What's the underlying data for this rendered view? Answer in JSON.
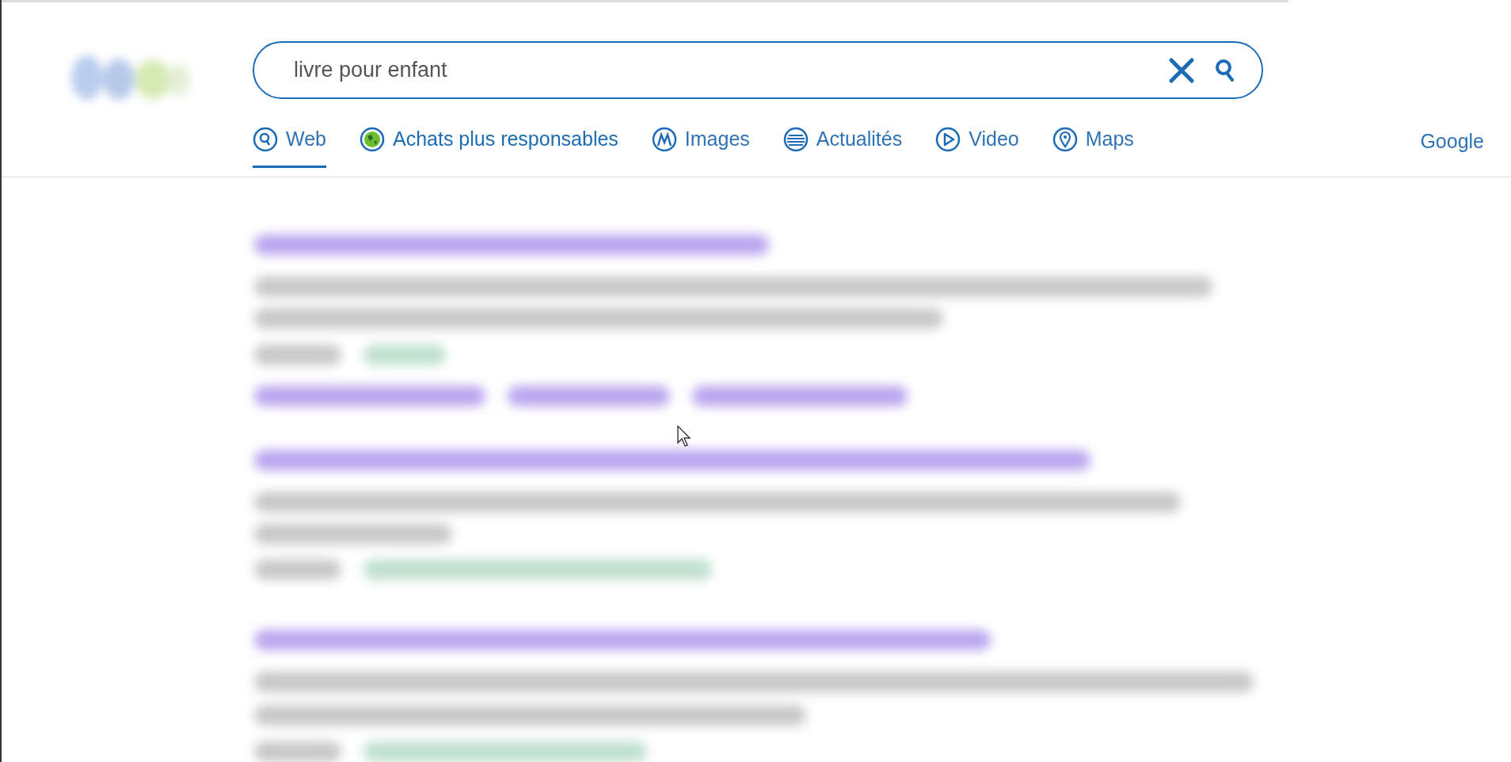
{
  "search": {
    "value": "livre pour enfant"
  },
  "tabs": [
    {
      "label": "Web",
      "selected": true,
      "kind": "search"
    },
    {
      "label": "Achats plus responsables",
      "selected": false,
      "kind": "globe"
    },
    {
      "label": "Images",
      "selected": false,
      "kind": "images"
    },
    {
      "label": "Actualités",
      "selected": false,
      "kind": "news"
    },
    {
      "label": "Video",
      "selected": false,
      "kind": "video"
    },
    {
      "label": "Maps",
      "selected": false,
      "kind": "maps"
    }
  ],
  "engine_link": "Google"
}
